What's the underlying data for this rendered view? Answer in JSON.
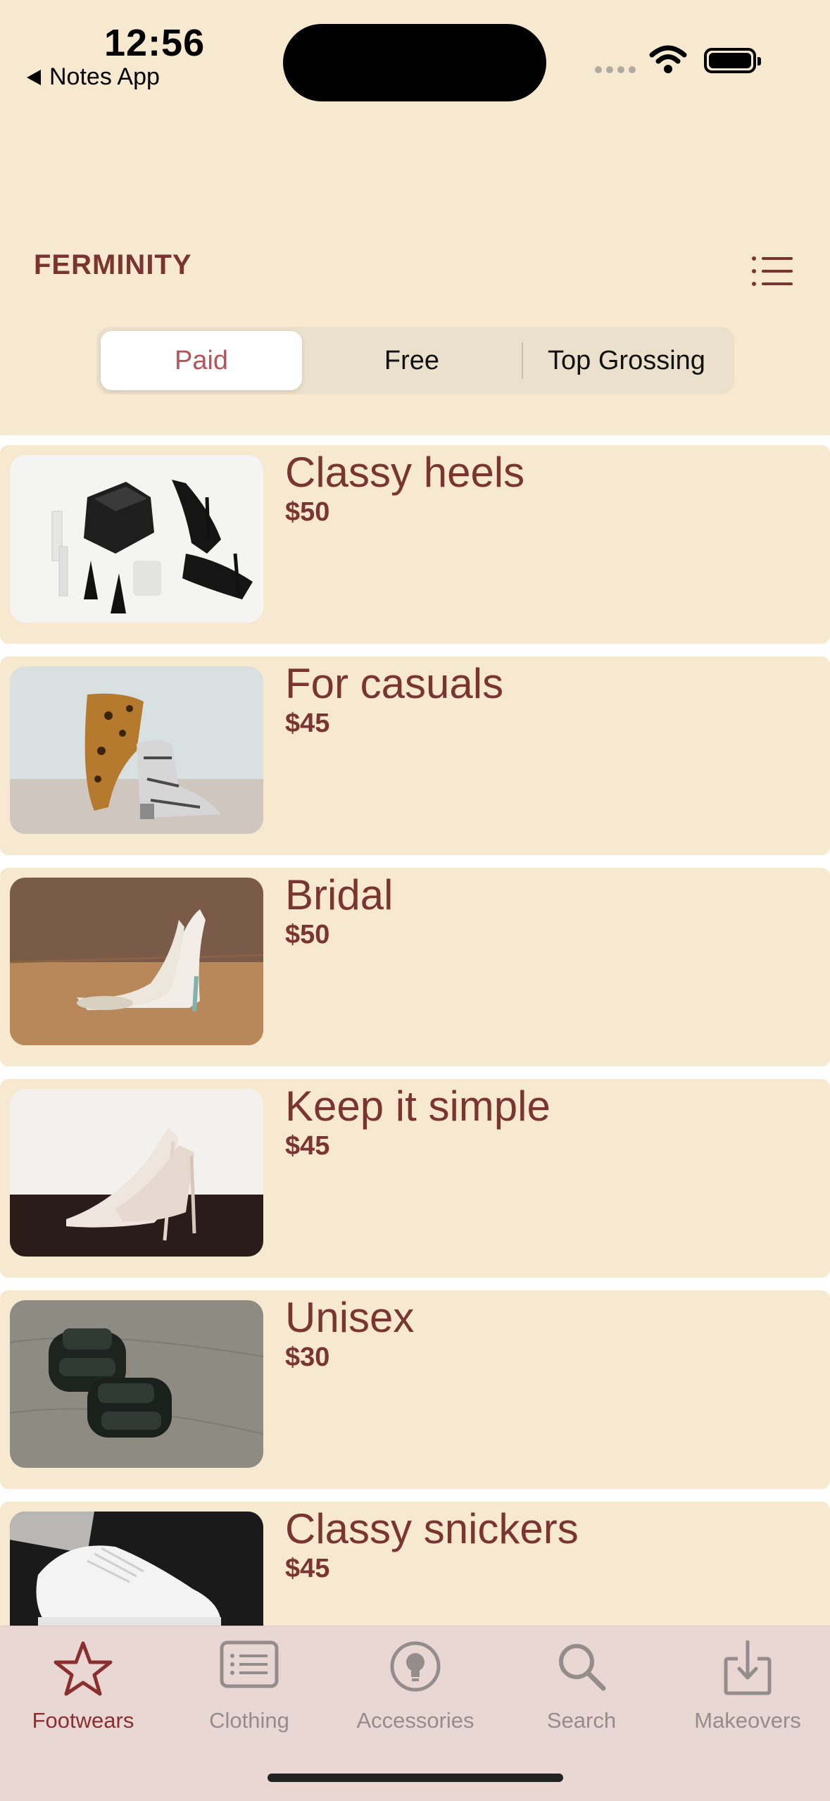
{
  "status": {
    "time": "12:56",
    "back_app": "Notes App"
  },
  "header": {
    "title": "FERMINITY"
  },
  "segments": [
    {
      "label": "Paid",
      "active": true
    },
    {
      "label": "Free",
      "active": false
    },
    {
      "label": "Top Grossing",
      "active": false
    }
  ],
  "products": [
    {
      "title": "Classy heels",
      "price": "$50",
      "image": "black-heels-clutch"
    },
    {
      "title": "For casuals",
      "price": "$45",
      "image": "leopard-snake-boots"
    },
    {
      "title": "Bridal",
      "price": "$50",
      "image": "white-bridal-heels"
    },
    {
      "title": "Keep it simple",
      "price": "$45",
      "image": "nude-pumps"
    },
    {
      "title": "Unisex",
      "price": "$30",
      "image": "black-sandals"
    },
    {
      "title": "Classy snickers",
      "price": "$45",
      "image": "white-sneakers"
    }
  ],
  "tabs": [
    {
      "label": "Footwears",
      "icon": "star-icon",
      "active": true
    },
    {
      "label": "Clothing",
      "icon": "list-card-icon",
      "active": false
    },
    {
      "label": "Accessories",
      "icon": "bulb-icon",
      "active": false
    },
    {
      "label": "Search",
      "icon": "search-icon",
      "active": false
    },
    {
      "label": "Makeovers",
      "icon": "download-icon",
      "active": false
    }
  ],
  "colors": {
    "background": "#f6e9cf",
    "accent": "#7a3530",
    "tabbar": "#e9d7d4",
    "active_segment_text": "#b5545a"
  }
}
